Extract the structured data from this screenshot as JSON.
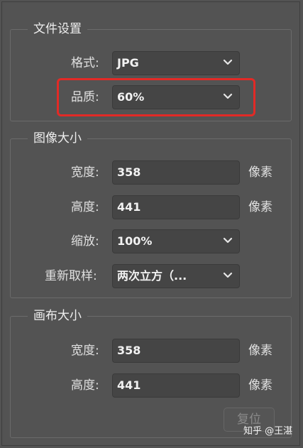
{
  "file_settings": {
    "title": "文件设置",
    "format_label": "格式:",
    "format_value": "JPG",
    "quality_label": "品质:",
    "quality_value": "60%"
  },
  "image_size": {
    "title": "图像大小",
    "width_label": "宽度:",
    "width_value": "358",
    "width_unit": "像素",
    "height_label": "高度:",
    "height_value": "441",
    "height_unit": "像素",
    "scale_label": "缩放:",
    "scale_value": "100%",
    "resample_label": "重新取样:",
    "resample_value": "两次立方（..."
  },
  "canvas_size": {
    "title": "画布大小",
    "width_label": "宽度:",
    "width_value": "358",
    "width_unit": "像素",
    "height_label": "高度:",
    "height_value": "441",
    "height_unit": "像素",
    "reset_label": "复位"
  },
  "watermark": "知乎 @王湛",
  "colors": {
    "panel_bg": "#535353",
    "field_bg": "#454545",
    "highlight": "#e22a26"
  },
  "icons": {
    "select_arrow": "chevron-down-icon"
  }
}
